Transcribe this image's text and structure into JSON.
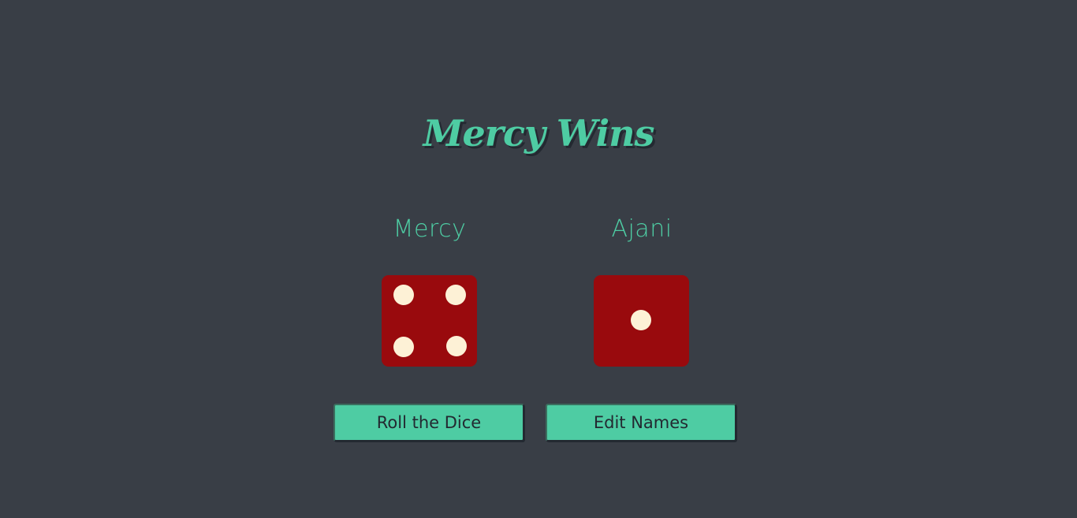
{
  "title": "Mercy Wins",
  "players": [
    {
      "name": "Mercy",
      "die_value": 4
    },
    {
      "name": "Ajani",
      "die_value": 1
    }
  ],
  "buttons": {
    "roll_label": "Roll the Dice",
    "edit_label": "Edit Names"
  },
  "colors": {
    "background": "#393e46",
    "accent": "#4ecca3",
    "die": "#990a0d",
    "pip": "#fdf1d6"
  }
}
